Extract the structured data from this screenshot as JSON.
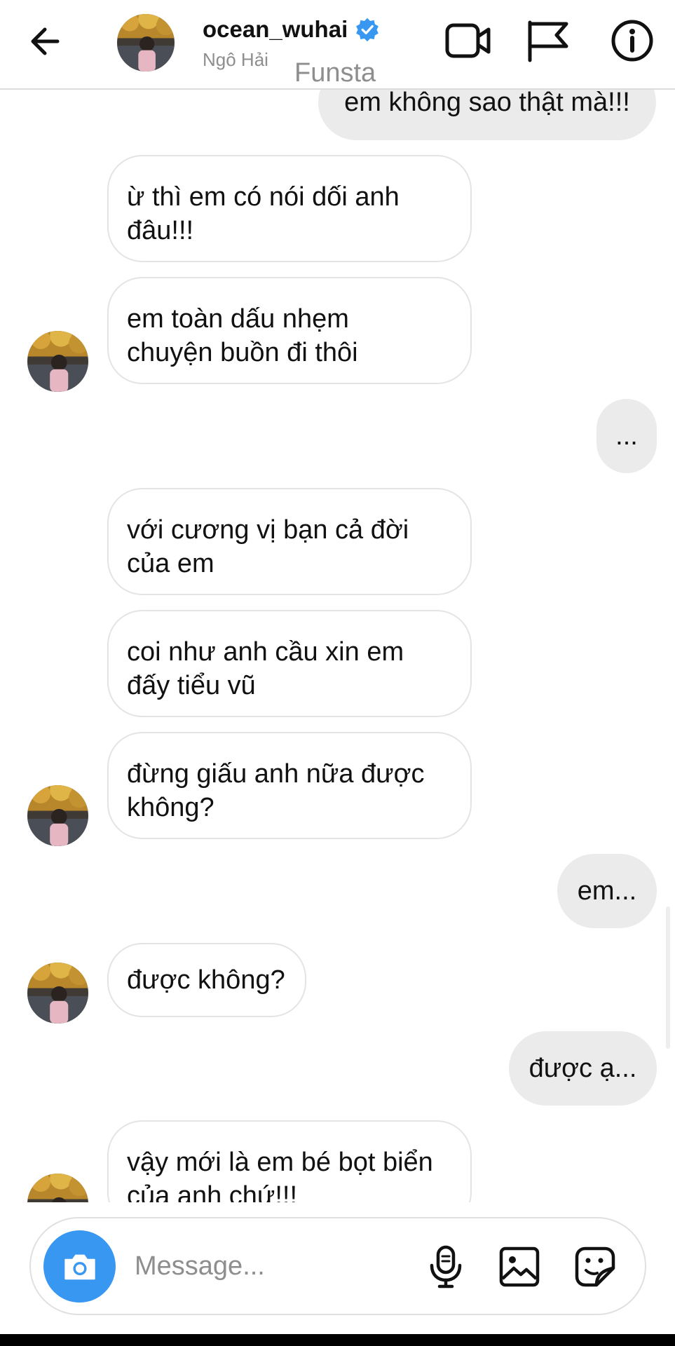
{
  "header": {
    "username": "ocean_wuhai",
    "full_name": "Ngô Hải",
    "watermark": "Funsta",
    "icons": [
      "back-arrow-icon",
      "verified-badge-icon",
      "video-call-icon",
      "flag-icon",
      "info-icon"
    ]
  },
  "messages": [
    {
      "from": "me",
      "text": "em không sao thật mà!!!"
    },
    {
      "from": "them",
      "text": "ừ thì em có nói dối anh\nđâu!!!"
    },
    {
      "from": "them",
      "text": "em toàn dấu nhẹm\nchuyện buồn đi thôi"
    },
    {
      "from": "me",
      "text": "..."
    },
    {
      "from": "them",
      "text": "với cương vị bạn cả đời\ncủa em"
    },
    {
      "from": "them",
      "text": "coi như anh cầu xin em\nđấy tiểu vũ"
    },
    {
      "from": "them",
      "text": "đừng giấu anh nữa được\nkhông?"
    },
    {
      "from": "me",
      "text": "em..."
    },
    {
      "from": "them",
      "text": "được không?"
    },
    {
      "from": "me",
      "text": "được ạ..."
    },
    {
      "from": "them",
      "text": "vậy mới là em bé bọt biển\ncủa anh chứ!!!"
    }
  ],
  "composer": {
    "placeholder": "Message...",
    "icons": [
      "camera-icon",
      "microphone-icon",
      "gallery-icon",
      "sticker-icon"
    ]
  },
  "colors": {
    "accent": "#3897f0",
    "outgoing_bubble": "#ebebeb",
    "incoming_border": "#e4e4e4",
    "secondary_text": "#8e8e8e"
  }
}
